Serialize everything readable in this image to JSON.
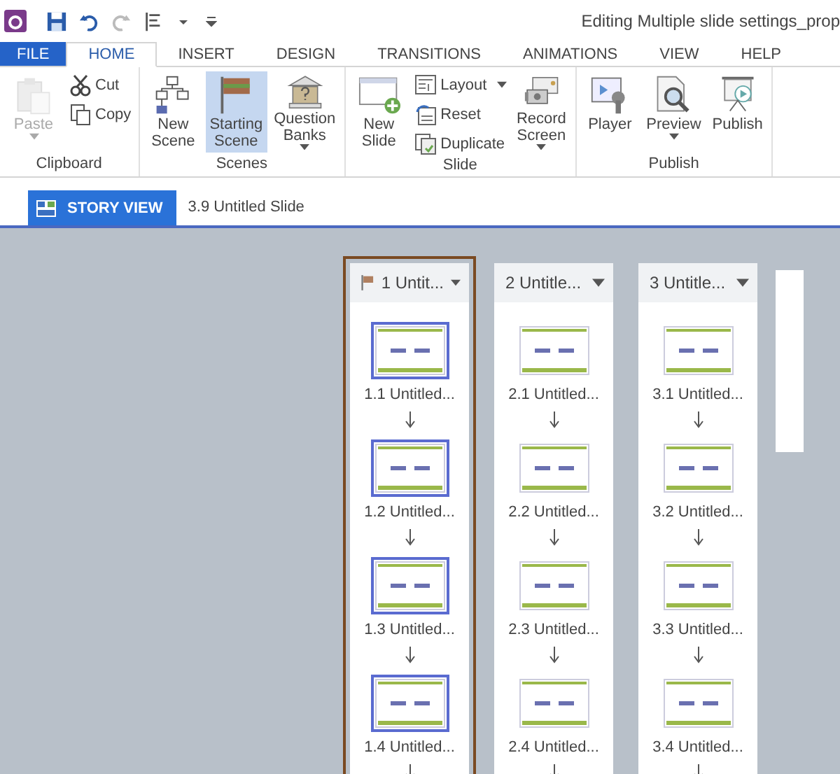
{
  "window": {
    "title": "Editing Multiple slide settings_prop"
  },
  "tabs": [
    {
      "label": "FILE",
      "kind": "file",
      "selected": false
    },
    {
      "label": "HOME",
      "kind": "tab",
      "selected": true
    },
    {
      "label": "INSERT",
      "kind": "tab",
      "selected": false
    },
    {
      "label": "DESIGN",
      "kind": "tab",
      "selected": false
    },
    {
      "label": "TRANSITIONS",
      "kind": "tab",
      "selected": false
    },
    {
      "label": "ANIMATIONS",
      "kind": "tab",
      "selected": false
    },
    {
      "label": "VIEW",
      "kind": "tab",
      "selected": false
    },
    {
      "label": "HELP",
      "kind": "tab",
      "selected": false
    }
  ],
  "ribbon": [
    {
      "name": "Clipboard",
      "buttons": [
        {
          "label": "Paste",
          "kind": "large",
          "disabled": true,
          "dropdown": true,
          "selected": false
        },
        {
          "label": "Cut",
          "kind": "small",
          "disabled": false,
          "dropdown": false,
          "selected": false
        },
        {
          "label": "Copy",
          "kind": "small",
          "disabled": false,
          "dropdown": false,
          "selected": false
        }
      ]
    },
    {
      "name": "Scenes",
      "buttons": [
        {
          "label": "New Scene",
          "kind": "large",
          "disabled": false,
          "dropdown": false,
          "selected": false
        },
        {
          "label": "Starting Scene",
          "kind": "large",
          "disabled": false,
          "dropdown": false,
          "selected": true
        },
        {
          "label": "Question Banks",
          "kind": "large",
          "disabled": false,
          "dropdown": true,
          "selected": false
        }
      ]
    },
    {
      "name": "Slide",
      "buttons": [
        {
          "label": "New Slide",
          "kind": "large",
          "disabled": false,
          "dropdown": false,
          "selected": false
        },
        {
          "label": "Layout",
          "kind": "small",
          "disabled": false,
          "dropdown": true,
          "selected": false
        },
        {
          "label": "Reset",
          "kind": "small",
          "disabled": false,
          "dropdown": false,
          "selected": false
        },
        {
          "label": "Duplicate",
          "kind": "small",
          "disabled": false,
          "dropdown": false,
          "selected": false
        },
        {
          "label": "Record Screen",
          "kind": "large",
          "disabled": false,
          "dropdown": true,
          "selected": false
        }
      ]
    },
    {
      "name": "Publish",
      "buttons": [
        {
          "label": "Player",
          "kind": "large",
          "disabled": false,
          "dropdown": false,
          "selected": false
        },
        {
          "label": "Preview",
          "kind": "large",
          "disabled": false,
          "dropdown": true,
          "selected": false
        },
        {
          "label": "Publish",
          "kind": "large",
          "disabled": false,
          "dropdown": false,
          "selected": false
        }
      ]
    }
  ],
  "view_bar": {
    "tab": "STORY VIEW",
    "breadcrumb": "3.9 Untitled Slide"
  },
  "scenes": [
    {
      "title": "1 Untit...",
      "selected": true,
      "starting": true,
      "slides": [
        {
          "label": "1.1 Untitled...",
          "selected": true
        },
        {
          "label": "1.2 Untitled...",
          "selected": true
        },
        {
          "label": "1.3 Untitled...",
          "selected": true
        },
        {
          "label": "1.4 Untitled...",
          "selected": true
        }
      ]
    },
    {
      "title": "2 Untitle...",
      "selected": false,
      "starting": false,
      "slides": [
        {
          "label": "2.1 Untitled...",
          "selected": false
        },
        {
          "label": "2.2 Untitled...",
          "selected": false
        },
        {
          "label": "2.3 Untitled...",
          "selected": false
        },
        {
          "label": "2.4 Untitled...",
          "selected": false
        }
      ]
    },
    {
      "title": "3 Untitle...",
      "selected": false,
      "starting": false,
      "slides": [
        {
          "label": "3.1 Untitled...",
          "selected": false
        },
        {
          "label": "3.2 Untitled...",
          "selected": false
        },
        {
          "label": "3.3 Untitled...",
          "selected": false
        },
        {
          "label": "3.4 Untitled...",
          "selected": false
        }
      ]
    }
  ]
}
